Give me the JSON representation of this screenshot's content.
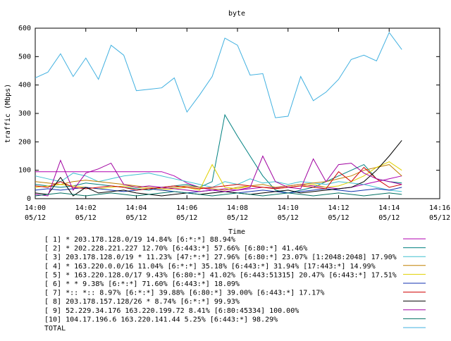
{
  "chart_data": {
    "type": "line",
    "title": "byte",
    "xlabel": "Time",
    "ylabel": "traffic (Mbps)",
    "ylim": [
      0,
      600
    ],
    "yticks": [
      "0",
      "100",
      "200",
      "300",
      "400",
      "500",
      "600"
    ],
    "xlim": [
      0,
      16
    ],
    "xticks": [
      {
        "t": 0,
        "time": "14:00",
        "date": "05/12"
      },
      {
        "t": 2,
        "time": "14:02",
        "date": "05/12"
      },
      {
        "t": 4,
        "time": "14:04",
        "date": "05/12"
      },
      {
        "t": 6,
        "time": "14:06",
        "date": "05/12"
      },
      {
        "t": 8,
        "time": "14:08",
        "date": "05/12"
      },
      {
        "t": 10,
        "time": "14:10",
        "date": "05/12"
      },
      {
        "t": 12,
        "time": "14:12",
        "date": "05/12"
      },
      {
        "t": 14,
        "time": "14:14",
        "date": "05/12"
      },
      {
        "t": 16,
        "time": "14:16",
        "date": "05/12"
      }
    ],
    "x": [
      0,
      0.5,
      1,
      1.5,
      2,
      2.5,
      3,
      3.5,
      4,
      4.5,
      5,
      5.5,
      6,
      6.5,
      7,
      7.5,
      8,
      8.5,
      9,
      9.5,
      10,
      10.5,
      11,
      11.5,
      12,
      12.5,
      13,
      13.5,
      14,
      14.5
    ],
    "series": [
      {
        "name": "[ 1] * 203.178.128.0/19 14.84%  [6:*:*] 88.94%",
        "color": "#b000b0",
        "values": [
          95,
          95,
          95,
          95,
          95,
          95,
          95,
          95,
          95,
          95,
          95,
          80,
          55,
          40,
          30,
          35,
          30,
          35,
          40,
          38,
          45,
          50,
          45,
          40,
          35,
          40,
          50,
          60,
          70,
          80
        ]
      },
      {
        "name": "[ 2] * 202.228.221.227 12.70%  [6:443:*] 57.66%  [6:80:*] 41.46%",
        "color": "#008080",
        "values": [
          50,
          45,
          40,
          45,
          55,
          50,
          45,
          40,
          35,
          30,
          40,
          45,
          50,
          40,
          60,
          295,
          220,
          150,
          80,
          30,
          20,
          30,
          40,
          60,
          80,
          100,
          120,
          70,
          60,
          55
        ]
      },
      {
        "name": "[ 3] 203.178.128.0/19 * 11.23%  [47:*:*] 27.96%  [6:80:*] 23.07%  [1:2048:2048] 17.90%",
        "color": "#40c0d0",
        "values": [
          80,
          70,
          60,
          90,
          80,
          60,
          70,
          80,
          85,
          90,
          80,
          70,
          60,
          50,
          40,
          60,
          50,
          70,
          55,
          60,
          50,
          60,
          55,
          50,
          60,
          55,
          50,
          40,
          30,
          25
        ]
      },
      {
        "name": "[ 4] * 163.220.0.0/16 11.04%  [6:*:*] 35.18%  [6:443:*] 31.94%  [17:443:*] 14.99%",
        "color": "#c08000",
        "values": [
          60,
          55,
          50,
          60,
          65,
          60,
          55,
          50,
          45,
          40,
          35,
          40,
          45,
          40,
          35,
          30,
          40,
          45,
          50,
          40,
          45,
          50,
          55,
          60,
          70,
          80,
          100,
          110,
          120,
          80
        ]
      },
      {
        "name": "[ 5] * 163.220.128.0/17 9.43%  [6:80:*] 41.02%  [6:443:51315] 20.47%  [6:443:*] 17.51%",
        "color": "#e0d000",
        "values": [
          40,
          45,
          50,
          45,
          40,
          35,
          40,
          45,
          40,
          35,
          30,
          35,
          40,
          30,
          120,
          40,
          35,
          45,
          40,
          35,
          40,
          45,
          50,
          40,
          45,
          60,
          80,
          110,
          130,
          100
        ]
      },
      {
        "name": "[ 6] * * 9.38%  [6:*:*] 71.60%  [6:443:*] 18.09%",
        "color": "#1030b0",
        "values": [
          30,
          35,
          30,
          35,
          40,
          35,
          30,
          25,
          30,
          35,
          30,
          25,
          20,
          25,
          30,
          25,
          20,
          25,
          30,
          25,
          20,
          25,
          30,
          35,
          30,
          25,
          30,
          35,
          30,
          40
        ]
      },
      {
        "name": "[ 7] *:: *:: 8.97%  [6:*:*] 39.88%  [6:80:*] 39.00%  [6:443:*] 17.17%",
        "color": "#d00000",
        "values": [
          45,
          40,
          60,
          40,
          35,
          40,
          45,
          40,
          30,
          35,
          40,
          45,
          40,
          35,
          40,
          45,
          50,
          45,
          40,
          35,
          40,
          45,
          40,
          35,
          95,
          60,
          110,
          70,
          40,
          50
        ]
      },
      {
        "name": "[ 8] 203.178.157.128/26 * 8.74%  [6:*:*] 99.93%",
        "color": "#000000",
        "values": [
          20,
          15,
          75,
          10,
          40,
          20,
          25,
          30,
          20,
          15,
          10,
          15,
          20,
          15,
          20,
          25,
          20,
          15,
          20,
          25,
          30,
          20,
          25,
          30,
          35,
          40,
          60,
          100,
          150,
          205
        ]
      },
      {
        "name": "[ 9] 52.229.34.176 163.220.199.72 8.41%  [6:80:45334] 100.00%",
        "color": "#a000a0",
        "values": [
          15,
          10,
          135,
          30,
          90,
          105,
          125,
          50,
          40,
          45,
          40,
          35,
          30,
          25,
          30,
          25,
          30,
          40,
          150,
          60,
          40,
          35,
          140,
          60,
          120,
          125,
          90,
          70,
          60,
          50
        ]
      },
      {
        "name": "[10] 104.17.196.6 163.220.141.44 5.25%  [6:443:*] 98.29%",
        "color": "#007060",
        "values": [
          10,
          15,
          20,
          15,
          10,
          15,
          20,
          15,
          10,
          15,
          20,
          25,
          20,
          15,
          10,
          15,
          20,
          15,
          10,
          15,
          20,
          15,
          10,
          15,
          20,
          15,
          10,
          15,
          20,
          15
        ]
      },
      {
        "name": "TOTAL",
        "color": "#40b0e0",
        "values": [
          425,
          445,
          510,
          430,
          495,
          420,
          540,
          505,
          380,
          385,
          390,
          425,
          305,
          365,
          430,
          565,
          540,
          435,
          440,
          285,
          290,
          430,
          345,
          375,
          420,
          490,
          505,
          485,
          585,
          525
        ]
      }
    ]
  }
}
